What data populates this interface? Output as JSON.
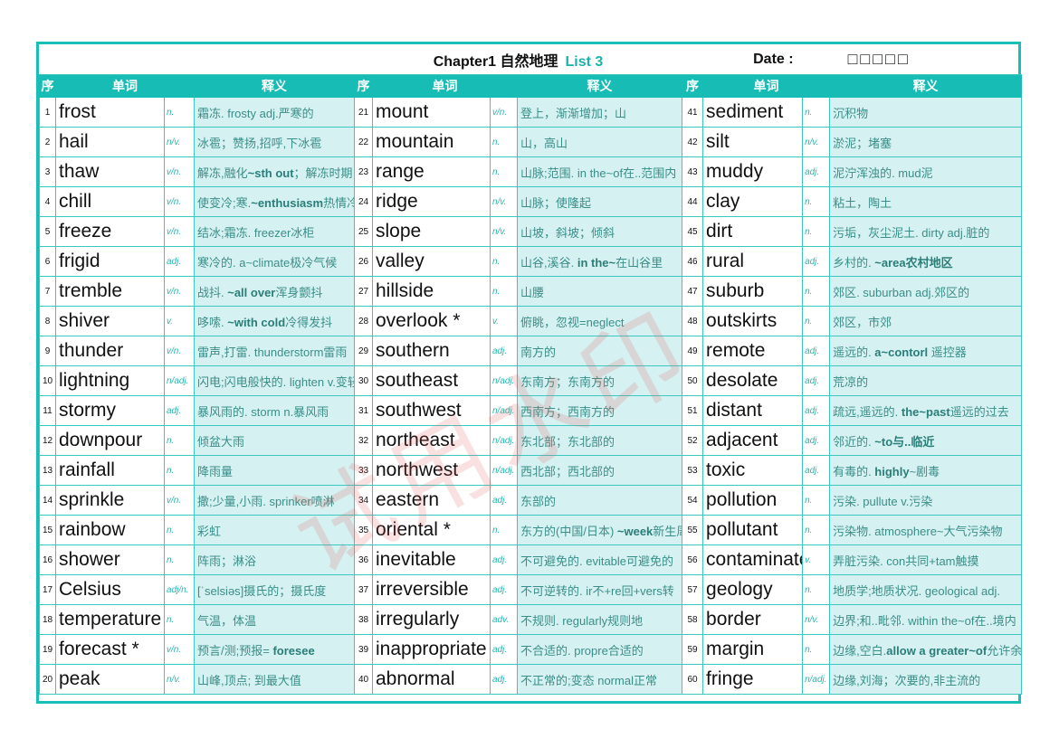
{
  "title": {
    "chapter": "Chapter1 自然地理",
    "list": "List 3",
    "date_label": "Date :",
    "date_boxes": "□□□□□"
  },
  "headers": {
    "seq": "序",
    "word": "单词",
    "def": "释义"
  },
  "watermark": "试用水印",
  "entries": [
    {
      "n": "1",
      "w": "frost",
      "p": "n.",
      "d1": "霜冻. frosty adj.严寒的"
    },
    {
      "n": "2",
      "w": "hail",
      "p": "n/v.",
      "d1": "冰雹；赞扬,招呼,下冰雹"
    },
    {
      "n": "3",
      "w": "thaw",
      "p": "v/n.",
      "d1": "解冻,融化",
      "b": "~sth out",
      "d2": "；解冻时期"
    },
    {
      "n": "4",
      "w": "chill",
      "p": "v/n.",
      "d1": "使变冷;寒.",
      "b": "~enthusiasm",
      "d2": "热情冷却"
    },
    {
      "n": "5",
      "w": "freeze",
      "p": "v/n.",
      "d1": "结冰;霜冻. freezer冰柜"
    },
    {
      "n": "6",
      "w": "frigid",
      "p": "adj.",
      "d1": "寒冷的. a~climate极冷气候"
    },
    {
      "n": "7",
      "w": "tremble",
      "p": "v/n.",
      "d1": "战抖. ",
      "b": "~all over",
      "d2": "浑身颤抖"
    },
    {
      "n": "8",
      "w": "shiver",
      "p": "v.",
      "d1": "哆嗦. ",
      "b": "~with cold",
      "d2": "冷得发抖"
    },
    {
      "n": "9",
      "w": "thunder",
      "p": "v/n.",
      "d1": "雷声,打雷. thunderstorm雷雨"
    },
    {
      "n": "10",
      "w": "lightning",
      "p": "n/adj.",
      "d1": "闪电;闪电般快的. lighten v.变轻"
    },
    {
      "n": "11",
      "w": "stormy",
      "p": "adj.",
      "d1": "暴风雨的. storm n.暴风雨"
    },
    {
      "n": "12",
      "w": "downpour",
      "p": "n.",
      "d1": "倾盆大雨"
    },
    {
      "n": "13",
      "w": "rainfall",
      "p": "n.",
      "d1": "降雨量"
    },
    {
      "n": "14",
      "w": "sprinkle",
      "p": "v/n.",
      "d1": "撒;少量,小雨. sprinker喷淋"
    },
    {
      "n": "15",
      "w": "rainbow",
      "p": "n.",
      "d1": "彩虹"
    },
    {
      "n": "16",
      "w": "shower",
      "p": "n.",
      "d1": "阵雨；淋浴"
    },
    {
      "n": "17",
      "w": "Celsius",
      "p": "adj/n.",
      "d1": "[ˈselsiəs]摄氏的；摄氏度"
    },
    {
      "n": "18",
      "w": "temperature",
      "p": "n.",
      "d1": "气温，体温"
    },
    {
      "n": "19",
      "w": "forecast *",
      "p": "v/n.",
      "d1": "预言/测;预报= ",
      "b": "foresee"
    },
    {
      "n": "20",
      "w": "peak",
      "p": "n/v.",
      "d1": "山峰,顶点; 到最大值"
    },
    {
      "n": "21",
      "w": "mount",
      "p": "v/n.",
      "d1": "登上，渐渐增加；山"
    },
    {
      "n": "22",
      "w": "mountain",
      "p": "n.",
      "d1": "山，高山"
    },
    {
      "n": "23",
      "w": "range",
      "p": "n.",
      "d1": "山脉;范围. in the~of在..范围内"
    },
    {
      "n": "24",
      "w": "ridge",
      "p": "n/v.",
      "d1": "山脉；使隆起"
    },
    {
      "n": "25",
      "w": "slope",
      "p": "n/v.",
      "d1": "山坡，斜坡；倾斜"
    },
    {
      "n": "26",
      "w": "valley",
      "p": "n.",
      "d1": "山谷,溪谷. ",
      "b": "in the~",
      "d2": "在山谷里"
    },
    {
      "n": "27",
      "w": "hillside",
      "p": "n.",
      "d1": "山腰"
    },
    {
      "n": "28",
      "w": "overlook *",
      "p": "v.",
      "d1": "俯眺，忽视=neglect"
    },
    {
      "n": "29",
      "w": "southern",
      "p": "adj.",
      "d1": "南方的"
    },
    {
      "n": "30",
      "w": "southeast",
      "p": "n/adj.",
      "d1": "东南方；东南方的"
    },
    {
      "n": "31",
      "w": "southwest",
      "p": "n/adj.",
      "d1": "西南方；西南方的"
    },
    {
      "n": "32",
      "w": "northeast",
      "p": "n/adj.",
      "d1": "东北部；东北部的"
    },
    {
      "n": "33",
      "w": "northwest",
      "p": "n/adj.",
      "d1": "西北部；西北部的"
    },
    {
      "n": "34",
      "w": "eastern",
      "p": "adj.",
      "d1": "东部的"
    },
    {
      "n": "35",
      "w": "oriental *",
      "p": "n.",
      "d1": "东方的(中国/日本) ",
      "b": "~week",
      "d2": "新生周"
    },
    {
      "n": "36",
      "w": "inevitable",
      "p": "adj.",
      "d1": "不可避免的. evitable可避免的"
    },
    {
      "n": "37",
      "w": "irreversible",
      "p": "adj.",
      "d1": "不可逆转的. ir不+re回+vers转"
    },
    {
      "n": "38",
      "w": "irregularly",
      "p": "adv.",
      "d1": "不规则. regularly规则地"
    },
    {
      "n": "39",
      "w": "inappropriate",
      "p": "adj.",
      "d1": "不合适的. propre合适的"
    },
    {
      "n": "40",
      "w": "abnormal",
      "p": "adj.",
      "d1": "不正常的;变态  normal正常"
    },
    {
      "n": "41",
      "w": "sediment",
      "p": "n.",
      "d1": "沉积物"
    },
    {
      "n": "42",
      "w": "silt",
      "p": "n/v.",
      "d1": "淤泥；堵塞"
    },
    {
      "n": "43",
      "w": "muddy",
      "p": "adj.",
      "d1": "泥泞浑浊的. mud泥"
    },
    {
      "n": "44",
      "w": "clay",
      "p": "n.",
      "d1": "粘土，陶土"
    },
    {
      "n": "45",
      "w": "dirt",
      "p": "n.",
      "d1": "污垢，灰尘泥土. dirty adj.脏的"
    },
    {
      "n": "46",
      "w": "rural",
      "p": "adj.",
      "d1": "乡村的. ",
      "b": "~area农村地区"
    },
    {
      "n": "47",
      "w": "suburb",
      "p": "n.",
      "d1": "郊区. suburban adj.郊区的"
    },
    {
      "n": "48",
      "w": "outskirts",
      "p": "n.",
      "d1": "郊区，市郊"
    },
    {
      "n": "49",
      "w": "remote",
      "p": "adj.",
      "d1": "遥远的. ",
      "b": "a~contorl",
      "d2": " 遥控器"
    },
    {
      "n": "50",
      "w": "desolate",
      "p": "adj.",
      "d1": "荒凉的"
    },
    {
      "n": "51",
      "w": "distant",
      "p": "adj.",
      "d1": "疏远,遥远的. ",
      "b": "the~past",
      "d2": "遥远的过去"
    },
    {
      "n": "52",
      "w": "adjacent",
      "p": "adj.",
      "d1": "邻近的. ",
      "b": "~to与..临近"
    },
    {
      "n": "53",
      "w": "toxic",
      "p": "adj.",
      "d1": "有毒的. ",
      "b": "highly",
      "d2": "~剧毒"
    },
    {
      "n": "54",
      "w": "pollution",
      "p": "n.",
      "d1": "污染. pullute v.污染"
    },
    {
      "n": "55",
      "w": "pollutant",
      "p": "n.",
      "d1": "污染物. atmosphere~大气污染物"
    },
    {
      "n": "56",
      "w": "contaminate",
      "p": "v.",
      "d1": "弄脏污染. con共同+tam触摸"
    },
    {
      "n": "57",
      "w": "geology",
      "p": "n.",
      "d1": "地质学;地质状况. geological adj."
    },
    {
      "n": "58",
      "w": "border",
      "p": "n/v.",
      "d1": "边界;和..毗邻. within the~of在..境内"
    },
    {
      "n": "59",
      "w": "margin",
      "p": "n.",
      "d1": "边缘,空白.",
      "b": "allow a greater~of",
      "d2": "允许余地"
    },
    {
      "n": "60",
      "w": "fringe",
      "p": "n/adj.",
      "d1": "边缘,刘海；次要的,非主流的"
    }
  ],
  "colors": {
    "accent": "#17bdb5",
    "def_bg": "#d5f1f1",
    "watermark": "#e65a5a"
  }
}
